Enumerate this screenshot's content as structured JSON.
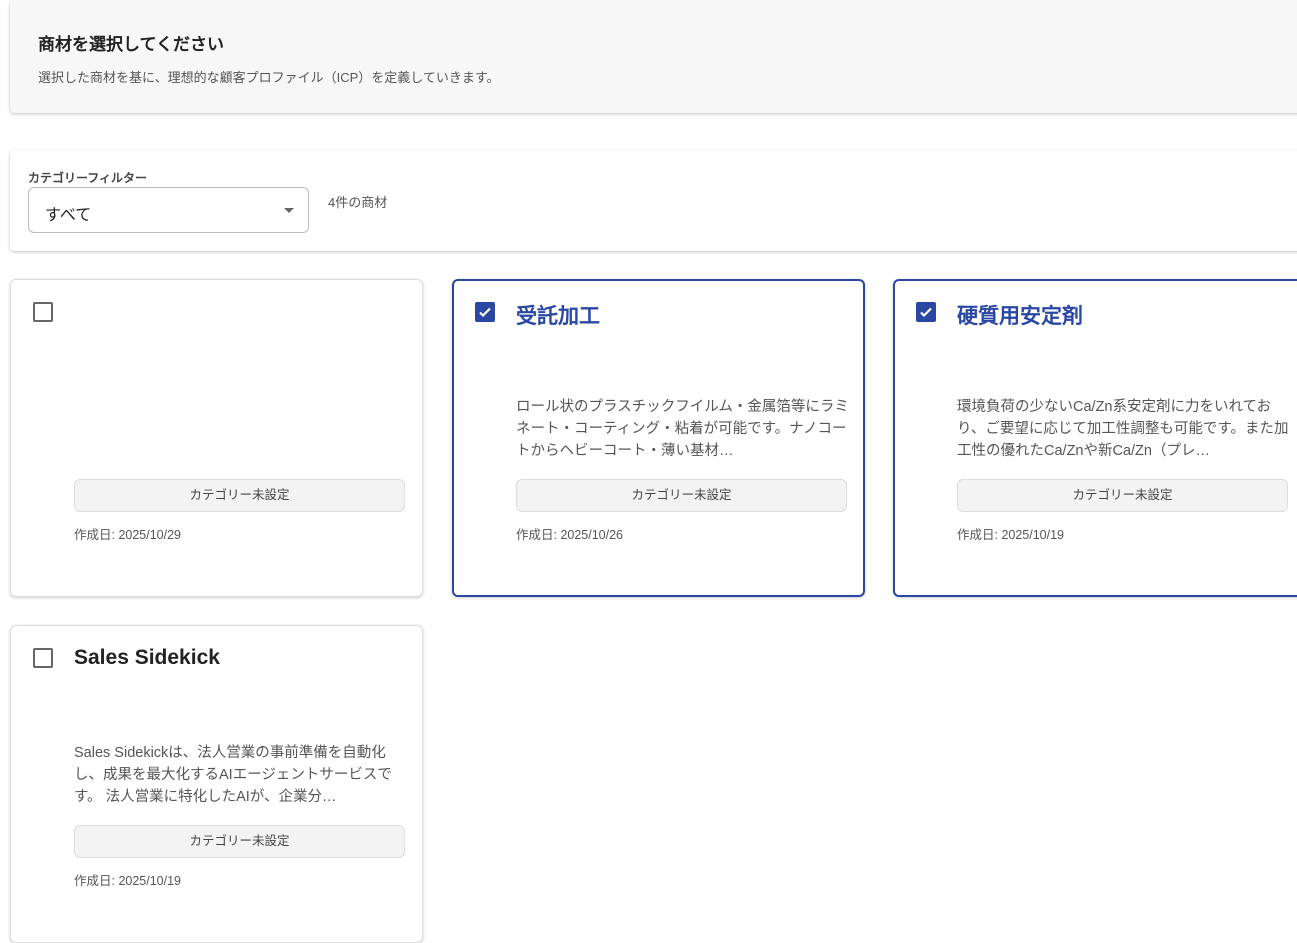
{
  "header": {
    "title": "商材を選択してください",
    "subtitle": "選択した商材を基に、理想的な顧客プロファイル（ICP）を定義していきます。"
  },
  "filter": {
    "label": "カテゴリーフィルター",
    "value": "すべて",
    "count": "4件の商材"
  },
  "accent": "#2a47a3",
  "cards": [
    {
      "title": "",
      "description": "",
      "category": "カテゴリー未設定",
      "date": "作成日: 2025/10/29",
      "selected": false
    },
    {
      "title": "受託加工",
      "description": "ロール状のプラスチックフイルム・金属箔等にラミネート・コーティング・粘着が可能です。ナノコートからヘビーコート・薄い基材…",
      "category": "カテゴリー未設定",
      "date": "作成日: 2025/10/26",
      "selected": true
    },
    {
      "title": "硬質用安定剤",
      "description": "環境負荷の少ないCa/Zn系安定剤に力をいれており、ご要望に応じて加工性調整も可能です。また加工性の優れたCa/Znや新Ca/Zn（プレ…",
      "category": "カテゴリー未設定",
      "date": "作成日: 2025/10/19",
      "selected": true
    },
    {
      "title": "Sales Sidekick",
      "description": "Sales Sidekickは、法人営業の事前準備を自動化し、成果を最大化するAIエージェントサービスです。 法人営業に特化したAIが、企業分…",
      "category": "カテゴリー未設定",
      "date": "作成日: 2025/10/19",
      "selected": false
    }
  ]
}
